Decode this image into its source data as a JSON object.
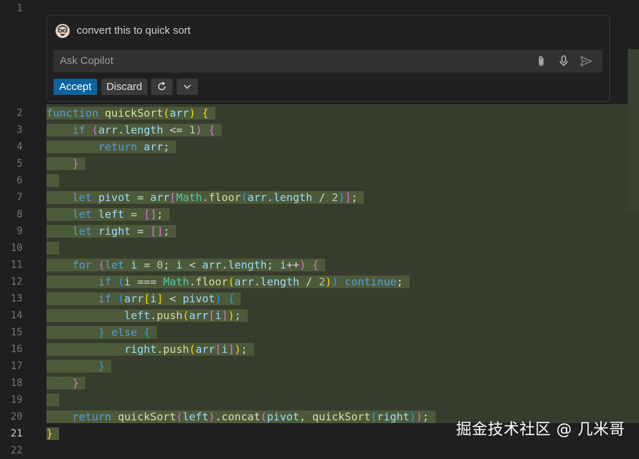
{
  "editor": {
    "line_numbers": [
      "1",
      "2",
      "3",
      "4",
      "5",
      "6",
      "7",
      "8",
      "9",
      "10",
      "11",
      "12",
      "13",
      "14",
      "15",
      "16",
      "17",
      "18",
      "19",
      "20",
      "21",
      "22"
    ],
    "active_line": "21"
  },
  "chat": {
    "prompt": "convert this to quick sort",
    "input_placeholder": "Ask Copilot",
    "accept_label": "Accept",
    "discard_label": "Discard",
    "icons": [
      "avatar",
      "attach-icon",
      "mic-icon",
      "send-icon",
      "regenerate-icon",
      "chevron-down-icon"
    ]
  },
  "code_lines": [
    [
      [
        "kw",
        "function"
      ],
      [
        "tx",
        " "
      ],
      [
        "fn",
        "quickSort"
      ],
      [
        "b1",
        "("
      ],
      [
        "vr",
        "arr"
      ],
      [
        "b1",
        ")"
      ],
      [
        "tx",
        " "
      ],
      [
        "b1",
        "{"
      ]
    ],
    [
      [
        "ws",
        "····"
      ],
      [
        "kw",
        "if"
      ],
      [
        "tx",
        " "
      ],
      [
        "b2",
        "("
      ],
      [
        "vr",
        "arr"
      ],
      [
        "tx",
        "."
      ],
      [
        "vr",
        "length"
      ],
      [
        "tx",
        " <= "
      ],
      [
        "nm",
        "1"
      ],
      [
        "b2",
        ")"
      ],
      [
        "tx",
        " "
      ],
      [
        "b2",
        "{"
      ]
    ],
    [
      [
        "ws",
        "········"
      ],
      [
        "kw",
        "return"
      ],
      [
        "tx",
        " "
      ],
      [
        "vr",
        "arr"
      ],
      [
        "tx",
        ";"
      ]
    ],
    [
      [
        "ws",
        "····"
      ],
      [
        "b2",
        "}"
      ]
    ],
    [],
    [
      [
        "ws",
        "····"
      ],
      [
        "kw",
        "let"
      ],
      [
        "tx",
        " "
      ],
      [
        "vr",
        "pivot"
      ],
      [
        "tx",
        " = "
      ],
      [
        "vr",
        "arr"
      ],
      [
        "b2",
        "["
      ],
      [
        "ty",
        "Math"
      ],
      [
        "tx",
        "."
      ],
      [
        "fn",
        "floor"
      ],
      [
        "b3",
        "("
      ],
      [
        "vr",
        "arr"
      ],
      [
        "tx",
        "."
      ],
      [
        "vr",
        "length"
      ],
      [
        "tx",
        " / "
      ],
      [
        "nm",
        "2"
      ],
      [
        "b3",
        ")"
      ],
      [
        "b2",
        "]"
      ],
      [
        "tx",
        ";"
      ]
    ],
    [
      [
        "ws",
        "····"
      ],
      [
        "kw",
        "let"
      ],
      [
        "tx",
        " "
      ],
      [
        "vr",
        "left"
      ],
      [
        "tx",
        " = "
      ],
      [
        "b2",
        "[]"
      ],
      [
        "tx",
        ";"
      ]
    ],
    [
      [
        "ws",
        "····"
      ],
      [
        "kw",
        "let"
      ],
      [
        "tx",
        " "
      ],
      [
        "vr",
        "right"
      ],
      [
        "tx",
        " = "
      ],
      [
        "b2",
        "[]"
      ],
      [
        "tx",
        ";"
      ]
    ],
    [],
    [
      [
        "ws",
        "····"
      ],
      [
        "kw",
        "for"
      ],
      [
        "tx",
        " "
      ],
      [
        "b2",
        "("
      ],
      [
        "kw",
        "let"
      ],
      [
        "tx",
        " "
      ],
      [
        "vr",
        "i"
      ],
      [
        "tx",
        " = "
      ],
      [
        "nm",
        "0"
      ],
      [
        "tx",
        "; "
      ],
      [
        "vr",
        "i"
      ],
      [
        "tx",
        " < "
      ],
      [
        "vr",
        "arr"
      ],
      [
        "tx",
        "."
      ],
      [
        "vr",
        "length"
      ],
      [
        "tx",
        "; "
      ],
      [
        "vr",
        "i"
      ],
      [
        "tx",
        "++"
      ],
      [
        "b2",
        ")"
      ],
      [
        "tx",
        " "
      ],
      [
        "b2",
        "{"
      ]
    ],
    [
      [
        "ws",
        "········"
      ],
      [
        "kw",
        "if"
      ],
      [
        "tx",
        " "
      ],
      [
        "b3",
        "("
      ],
      [
        "vr",
        "i"
      ],
      [
        "tx",
        " === "
      ],
      [
        "ty",
        "Math"
      ],
      [
        "tx",
        "."
      ],
      [
        "fn",
        "floor"
      ],
      [
        "b1",
        "("
      ],
      [
        "vr",
        "arr"
      ],
      [
        "tx",
        "."
      ],
      [
        "vr",
        "length"
      ],
      [
        "tx",
        " / "
      ],
      [
        "nm",
        "2"
      ],
      [
        "b1",
        ")"
      ],
      [
        "b3",
        ")"
      ],
      [
        "tx",
        " "
      ],
      [
        "kw",
        "continue"
      ],
      [
        "tx",
        ";"
      ]
    ],
    [
      [
        "ws",
        "········"
      ],
      [
        "kw",
        "if"
      ],
      [
        "tx",
        " "
      ],
      [
        "b3",
        "("
      ],
      [
        "vr",
        "arr"
      ],
      [
        "b1",
        "["
      ],
      [
        "vr",
        "i"
      ],
      [
        "b1",
        "]"
      ],
      [
        "tx",
        " < "
      ],
      [
        "vr",
        "pivot"
      ],
      [
        "b3",
        ")"
      ],
      [
        "tx",
        " "
      ],
      [
        "b3",
        "{"
      ]
    ],
    [
      [
        "ws",
        "············"
      ],
      [
        "vr",
        "left"
      ],
      [
        "tx",
        "."
      ],
      [
        "fn",
        "push"
      ],
      [
        "b1",
        "("
      ],
      [
        "vr",
        "arr"
      ],
      [
        "b2",
        "["
      ],
      [
        "vr",
        "i"
      ],
      [
        "b2",
        "]"
      ],
      [
        "b1",
        ")"
      ],
      [
        "tx",
        ";"
      ]
    ],
    [
      [
        "ws",
        "········"
      ],
      [
        "b3",
        "}"
      ],
      [
        "tx",
        " "
      ],
      [
        "kw",
        "else"
      ],
      [
        "tx",
        " "
      ],
      [
        "b3",
        "{"
      ]
    ],
    [
      [
        "ws",
        "············"
      ],
      [
        "vr",
        "right"
      ],
      [
        "tx",
        "."
      ],
      [
        "fn",
        "push"
      ],
      [
        "b1",
        "("
      ],
      [
        "vr",
        "arr"
      ],
      [
        "b2",
        "["
      ],
      [
        "vr",
        "i"
      ],
      [
        "b2",
        "]"
      ],
      [
        "b1",
        ")"
      ],
      [
        "tx",
        ";"
      ]
    ],
    [
      [
        "ws",
        "········"
      ],
      [
        "b3",
        "}"
      ]
    ],
    [
      [
        "ws",
        "····"
      ],
      [
        "b2",
        "}"
      ]
    ],
    [],
    [
      [
        "ws",
        "····"
      ],
      [
        "kw",
        "return"
      ],
      [
        "tx",
        " "
      ],
      [
        "fn",
        "quickSort"
      ],
      [
        "b2",
        "("
      ],
      [
        "vr",
        "left"
      ],
      [
        "b2",
        ")"
      ],
      [
        "tx",
        "."
      ],
      [
        "fn",
        "concat"
      ],
      [
        "b2",
        "("
      ],
      [
        "vr",
        "pivot"
      ],
      [
        "tx",
        ", "
      ],
      [
        "fn",
        "quickSort"
      ],
      [
        "b3",
        "("
      ],
      [
        "vr",
        "right"
      ],
      [
        "b3",
        ")"
      ],
      [
        "b2",
        ")"
      ],
      [
        "tx",
        ";"
      ]
    ],
    [
      [
        "b1",
        "}"
      ]
    ]
  ],
  "watermark": "掘金技术社区 @ 几米哥"
}
